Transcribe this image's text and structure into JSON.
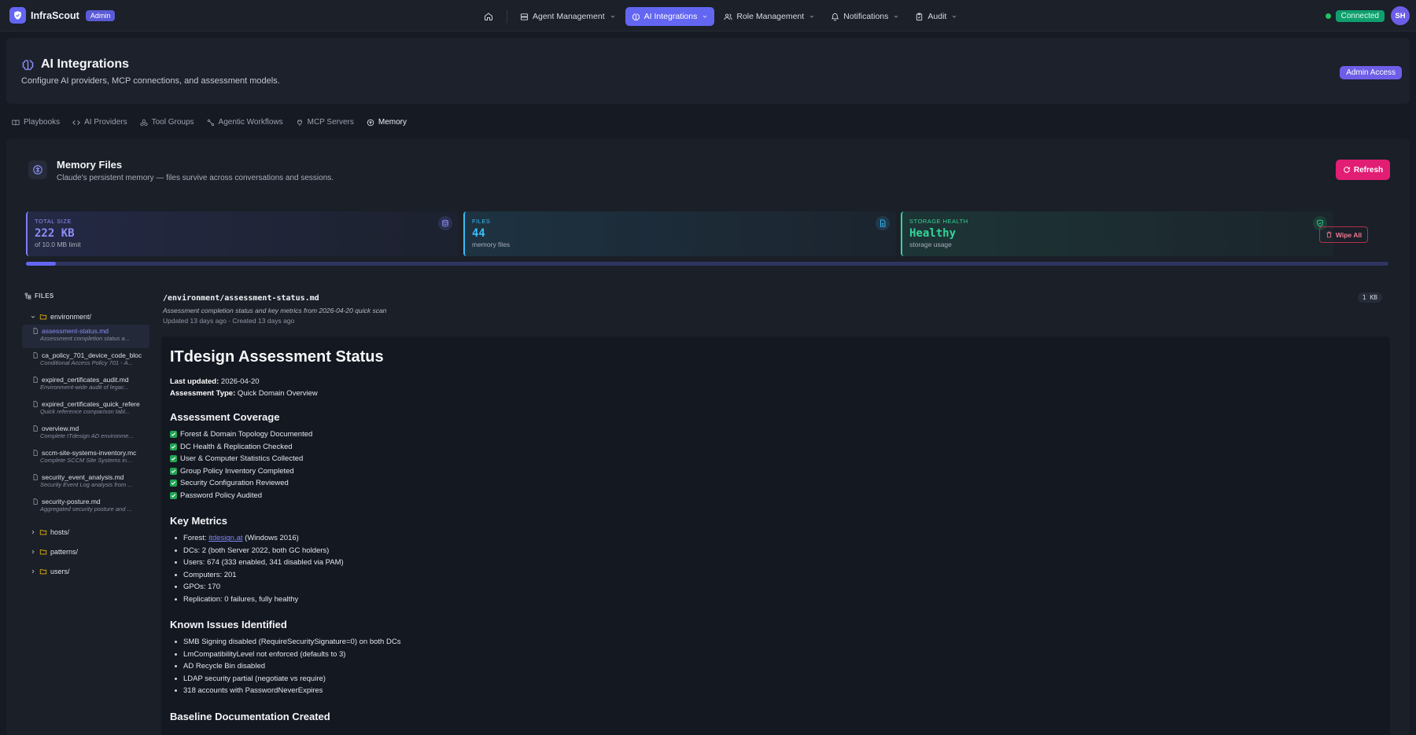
{
  "brand": {
    "name": "InfraScout",
    "badge": "Admin"
  },
  "nav": {
    "items": [
      {
        "label": "Agent Management",
        "icon": "server-icon",
        "active": false
      },
      {
        "label": "AI Integrations",
        "icon": "brain-icon",
        "active": true
      },
      {
        "label": "Role Management",
        "icon": "users-icon",
        "active": false
      },
      {
        "label": "Notifications",
        "icon": "bell-icon",
        "active": false
      },
      {
        "label": "Audit",
        "icon": "clipboard-icon",
        "active": false
      }
    ],
    "status": "Connected",
    "avatar_initials": "SH"
  },
  "header": {
    "title": "AI Integrations",
    "subtitle": "Configure AI providers, MCP connections, and assessment models.",
    "badge": "Admin Access"
  },
  "tabs": [
    {
      "label": "Playbooks",
      "icon": "book-icon"
    },
    {
      "label": "AI Providers",
      "icon": "code-icon"
    },
    {
      "label": "Tool Groups",
      "icon": "tools-icon"
    },
    {
      "label": "Agentic Workflows",
      "icon": "workflow-icon"
    },
    {
      "label": "MCP Servers",
      "icon": "plug-icon"
    },
    {
      "label": "Memory",
      "icon": "memory-icon",
      "active": true
    }
  ],
  "memory": {
    "title": "Memory Files",
    "subtitle": "Claude's persistent memory — files survive across conversations and sessions.",
    "refresh_label": "Refresh",
    "wipe_label": "Wipe All",
    "usage_fraction": 0.0217,
    "stats": [
      {
        "label": "TOTAL SIZE",
        "value": "222 KB",
        "sub": "of 10.0 MB limit",
        "color": "#7c7ff5"
      },
      {
        "label": "FILES",
        "value": "44",
        "sub": "memory files",
        "color": "#38bdf8"
      },
      {
        "label": "STORAGE HEALTH",
        "value": "Healthy",
        "sub": "storage usage",
        "color": "#34d399"
      }
    ]
  },
  "files": {
    "heading": "FILES",
    "open_folder": "environment/",
    "items": [
      {
        "name": "assessment-status.md",
        "desc": "Assessment completion status a...",
        "active": true
      },
      {
        "name": "ca_policy_701_device_code_bloc",
        "desc": "Conditional Access Policy 701 - A..."
      },
      {
        "name": "expired_certificates_audit.md",
        "desc": "Environment-wide audit of legac..."
      },
      {
        "name": "expired_certificates_quick_refere",
        "desc": "Quick reference comparison tabl..."
      },
      {
        "name": "overview.md",
        "desc": "Complete ITdesign AD environme..."
      },
      {
        "name": "sccm-site-systems-inventory.mc",
        "desc": "Complete SCCM Site Systems in..."
      },
      {
        "name": "security_event_analysis.md",
        "desc": "Security Event Log analysis from ..."
      },
      {
        "name": "security-posture.md",
        "desc": "Aggregated security posture and ..."
      }
    ],
    "folders": [
      "hosts/",
      "patterns/",
      "users/"
    ]
  },
  "doc": {
    "path": "/environment/assessment-status.md",
    "desc": "Assessment completion status and key metrics from 2026-04-20 quick scan",
    "meta": "Updated 13 days ago · Created 13 days ago",
    "size": "1 KB",
    "h1": "ITdesign Assessment Status",
    "last_updated_label": "Last updated:",
    "last_updated_value": " 2026-04-20",
    "type_label": "Assessment Type:",
    "type_value": " Quick Domain Overview",
    "coverage_title": "Assessment Coverage",
    "coverage": [
      "Forest & Domain Topology Documented",
      "DC Health & Replication Checked",
      "User & Computer Statistics Collected",
      "Group Policy Inventory Completed",
      "Security Configuration Reviewed",
      "Password Policy Audited"
    ],
    "metrics_title": "Key Metrics",
    "forest_prefix": "Forest: ",
    "forest_link": "itdesign.at",
    "forest_suffix": " (Windows 2016)",
    "metrics": [
      "DCs: 2 (both Server 2022, both GC holders)",
      "Users: 674 (333 enabled, 341 disabled via PAM)",
      "Computers: 201",
      "GPOs: 170",
      "Replication: 0 failures, fully healthy"
    ],
    "issues_title": "Known Issues Identified",
    "issues": [
      "SMB Signing disabled (RequireSecuritySignature=0) on both DCs",
      "LmCompatibilityLevel not enforced (defaults to 3)",
      "AD Recycle Bin disabled",
      "LDAP security partial (negotiate vs require)",
      "318 accounts with PasswordNeverExpires"
    ],
    "baseline_title": "Baseline Documentation Created"
  }
}
